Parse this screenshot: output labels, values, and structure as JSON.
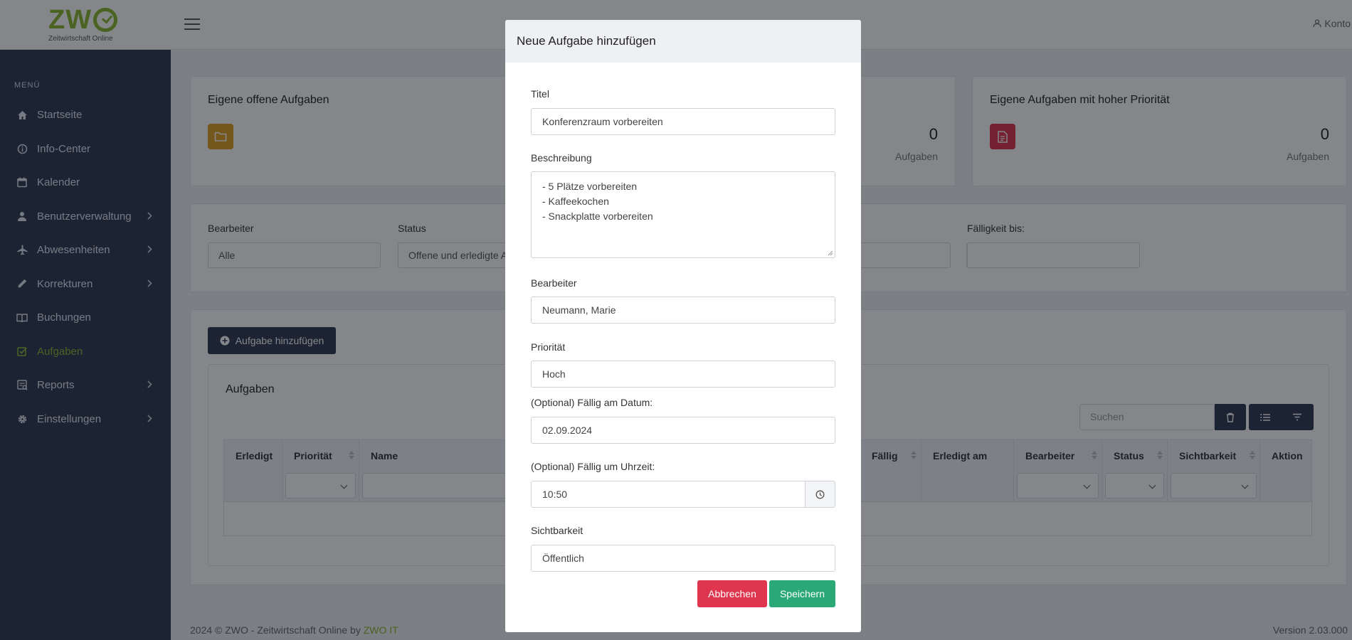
{
  "app": {
    "logo_text": "ZW",
    "logo_sub": "Zeitwirtschaft Online",
    "account": "Konto"
  },
  "sidebar": {
    "menu_title": "MENÜ",
    "items": [
      {
        "label": "Startseite",
        "icon": "home-icon"
      },
      {
        "label": "Info-Center",
        "icon": "info-icon"
      },
      {
        "label": "Kalender",
        "icon": "calendar-icon"
      },
      {
        "label": "Benutzerverwaltung",
        "icon": "user-icon",
        "has_submenu": true
      },
      {
        "label": "Abwesenheiten",
        "icon": "plane-icon",
        "has_submenu": true
      },
      {
        "label": "Korrekturen",
        "icon": "pencil-icon",
        "has_submenu": true
      },
      {
        "label": "Buchungen",
        "icon": "book-icon"
      },
      {
        "label": "Aufgaben",
        "icon": "checkbox-icon",
        "active": true
      },
      {
        "label": "Reports",
        "icon": "report-icon",
        "has_submenu": true
      },
      {
        "label": "Einstellungen",
        "icon": "gear-icon",
        "has_submenu": true
      }
    ]
  },
  "tiles": {
    "open": {
      "title": "Eigene offene Aufgaben",
      "icon": "folder-icon",
      "color": "#e0a020"
    },
    "middle": {
      "count": "0",
      "unit": "Aufgaben"
    },
    "high": {
      "title": "Eigene Aufgaben mit hoher Priorität",
      "count": "0",
      "unit": "Aufgaben",
      "icon": "document-icon",
      "color": "#e0354f"
    }
  },
  "filters": {
    "bearbeiter_label": "Bearbeiter",
    "bearbeiter_value": "Alle",
    "status_label": "Status",
    "status_value": "Offene und erledigte A",
    "faellig_bis_label": "Fälligkeit bis:",
    "faellig_bis_value": ""
  },
  "tasks": {
    "add_button": "Aufgabe hinzufügen",
    "section_title": "Aufgaben",
    "search_placeholder": "Suchen",
    "columns": [
      "Erledigt",
      "Priorität",
      "Name",
      "Fällig",
      "Erledigt am",
      "Bearbeiter",
      "Status",
      "Sichtbarkeit",
      "Aktion"
    ]
  },
  "footer": {
    "copyright_prefix": "2024 © ZWO - Zeitwirtschaft Online by ",
    "copyright_link": "ZWO IT",
    "version": "Version 2.03.000"
  },
  "modal": {
    "title": "Neue Aufgabe hinzufügen",
    "titel_label": "Titel",
    "titel_value": "Konferenzraum vorbereiten",
    "beschreibung_label": "Beschreibung",
    "beschreibung_lines": [
      "- 5 Plätze vorbereiten",
      "- Kaffeekochen",
      "- Snackplatte vorbereiten"
    ],
    "bearbeiter_label": "Bearbeiter",
    "bearbeiter_value": "Neumann, Marie",
    "prioritaet_label": "Priorität",
    "prioritaet_value": "Hoch",
    "datum_label": "(Optional) Fällig am Datum:",
    "datum_value": "02.09.2024",
    "uhrzeit_label": "(Optional) Fällig um Uhrzeit:",
    "uhrzeit_value": "10:50",
    "sichtbarkeit_label": "Sichtbarkeit",
    "sichtbarkeit_value": "Öffentlich",
    "cancel": "Abbrechen",
    "save": "Speichern"
  },
  "colors": {
    "brand": "#8ab82f",
    "sidebar": "#2f3b52",
    "danger": "#e0354f",
    "success": "#2aa876"
  }
}
